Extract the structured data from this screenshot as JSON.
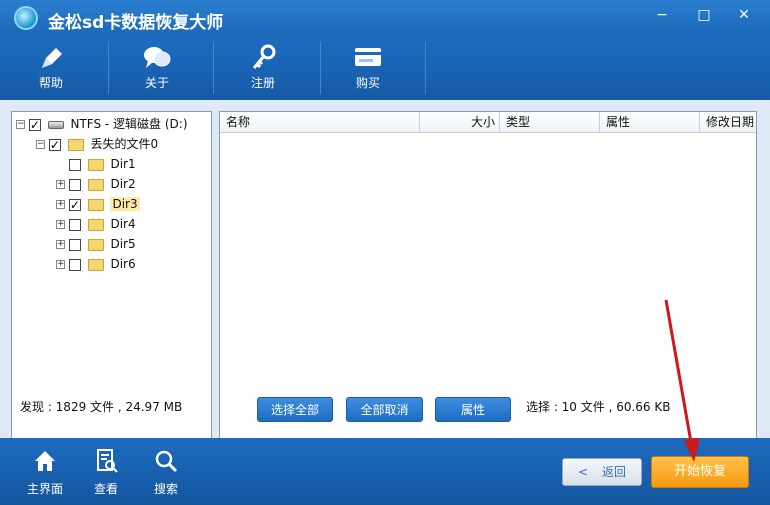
{
  "window": {
    "title": "金松sd卡数据恢复大师",
    "minimize": "−",
    "maximize": "□",
    "close": "✕"
  },
  "toolbar": [
    {
      "label": "帮助",
      "icon": "pen-icon"
    },
    {
      "label": "关于",
      "icon": "chat-bubbles-icon"
    },
    {
      "label": "注册",
      "icon": "key-icon"
    },
    {
      "label": "购买",
      "icon": "card-icon"
    }
  ],
  "tree": {
    "root": {
      "label": "NTFS - 逻辑磁盘 (D:)",
      "checked": true,
      "expander": "−"
    },
    "lost": {
      "label": "丢失的文件0",
      "checked": true,
      "expander": "−"
    },
    "dirs": [
      {
        "label": "Dir1",
        "checked": false,
        "expander": ""
      },
      {
        "label": "Dir2",
        "checked": false,
        "expander": "+"
      },
      {
        "label": "Dir3",
        "checked": true,
        "expander": "+"
      },
      {
        "label": "Dir4",
        "checked": false,
        "expander": "+"
      },
      {
        "label": "Dir5",
        "checked": false,
        "expander": "+"
      },
      {
        "label": "Dir6",
        "checked": false,
        "expander": "+"
      }
    ]
  },
  "list": {
    "columns": [
      "名称",
      "大小",
      "类型",
      "属性",
      "修改日期"
    ],
    "scroll_left": "<",
    "scroll_right": ">"
  },
  "status": {
    "found": "发现 : 1829 文件 , 24.97 MB",
    "selected": "选择 : 10 文件 , 60.66 KB"
  },
  "actions": {
    "select_all": "选择全部",
    "deselect_all": "全部取消",
    "properties": "属性"
  },
  "bottom_nav": [
    {
      "label": "主界面",
      "icon": "home-icon"
    },
    {
      "label": "查看",
      "icon": "document-view-icon"
    },
    {
      "label": "搜索",
      "icon": "search-icon"
    }
  ],
  "footer_buttons": {
    "back": "返回",
    "back_icon": "<",
    "recover": "开始恢复"
  },
  "colors": {
    "accent": "#1c68b8",
    "recover_button": "#f59a10",
    "annotation_arrow": "#d01818"
  }
}
